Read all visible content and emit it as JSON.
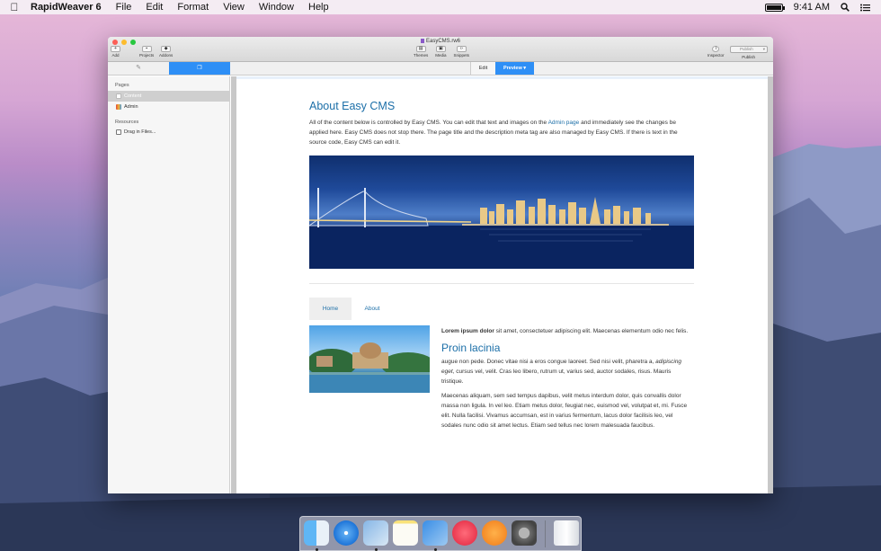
{
  "menubar": {
    "apple_icon": "apple-icon",
    "app_name": "RapidWeaver 6",
    "menus": [
      "File",
      "Edit",
      "Format",
      "View",
      "Window",
      "Help"
    ],
    "clock": "9:41 AM"
  },
  "window": {
    "title": "EasyCMS.rw6",
    "toolbar": {
      "add": "Add",
      "projects": "Projects",
      "addons": "Addons",
      "themes": "Themes",
      "media": "Media",
      "snippets": "Snippets",
      "inspector": "Inspector",
      "publish_placeholder": "Publish",
      "publish": "Publish"
    },
    "mode_tabs": {
      "edit": "Edit",
      "preview": "Preview"
    }
  },
  "sidebar": {
    "pages_header": "Pages",
    "pages": [
      {
        "label": "Content",
        "selected": true
      },
      {
        "label": "Admin",
        "selected": false
      }
    ],
    "resources_header": "Resources",
    "resources": [
      {
        "label": "Drag in Files..."
      }
    ]
  },
  "page": {
    "title": "About Easy CMS",
    "intro_before_link": "All of the content below is controlled by Easy CMS. You can edit that text and images on the ",
    "intro_link": "Admin page",
    "intro_after_link": " and immediately see the changes be applied here. Easy CMS does not stop there. The page title and the description meta tag are also managed by Easy CMS. If there is text in the source code, Easy CMS can edit it.",
    "nav": [
      "Home",
      "About"
    ],
    "lorem_bold": "Lorem ipsum dolor",
    "lorem_rest": " sit amet, consectetuer adipiscing elit. Maecenas elementum odio nec felis.",
    "subtitle": "Proin lacinia",
    "para1_a": "augue non pede. Donec vitae nisi a eros congue laoreet. Sed nisi velit, pharetra a, ",
    "para1_italic": "adipiscing eget",
    "para1_b": ", cursus vel, velit. Cras leo libero, rutrum ut, varius sed, auctor sodales, risus. Mauris tristique.",
    "para2": "Maecenas aliquam, sem sed tempus dapibus, velit metus interdum dolor, quis convallis dolor massa non ligula. In vel leo. Etiam metus dolor, feugiat nec, euismod vel, volutpat et, mi. Fusce elit. Nulla facilisi. Vivamus accumsan, est in varius fermentum, lacus dolor facilisis leo, vel sodales nunc odio sit amet lectus. Etiam sed tellus nec lorem malesuada faucibus."
  },
  "dock": {
    "items": [
      "finder-icon",
      "safari-icon",
      "rapidweaver-icon",
      "notes-icon",
      "stacks-icon",
      "itunes-icon",
      "ibooks-icon",
      "system-preferences-icon",
      "trash-icon"
    ]
  }
}
